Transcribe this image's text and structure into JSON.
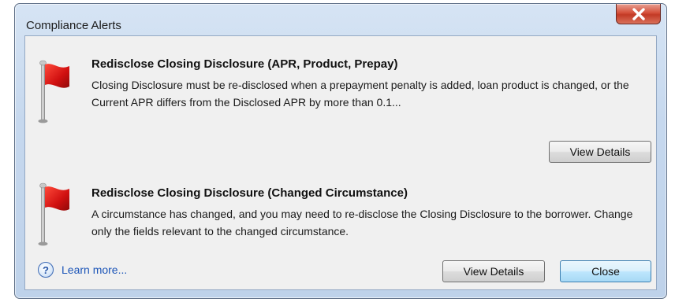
{
  "window": {
    "title": "Compliance Alerts"
  },
  "alerts": [
    {
      "icon": "red-flag-icon",
      "title": "Redisclose Closing Disclosure (APR, Product, Prepay)",
      "description": "Closing Disclosure must be re-disclosed when a prepayment penalty is added, loan product is changed, or the Current APR differs from the Disclosed APR by more than 0.1...",
      "button_label": "View Details"
    },
    {
      "icon": "red-flag-icon",
      "title": "Redisclose Closing Disclosure (Changed Circumstance)",
      "description": "A circumstance has changed, and you may need to re-disclose the Closing Disclosure to the borrower. Change only the fields relevant to the changed circumstance.",
      "button_label": "View Details"
    }
  ],
  "footer": {
    "help_icon": "?",
    "learn_more": "Learn more...",
    "close_label": "Close"
  },
  "colors": {
    "flag": "#d01010",
    "link": "#1c55b8",
    "close_x": "#c33a25"
  }
}
